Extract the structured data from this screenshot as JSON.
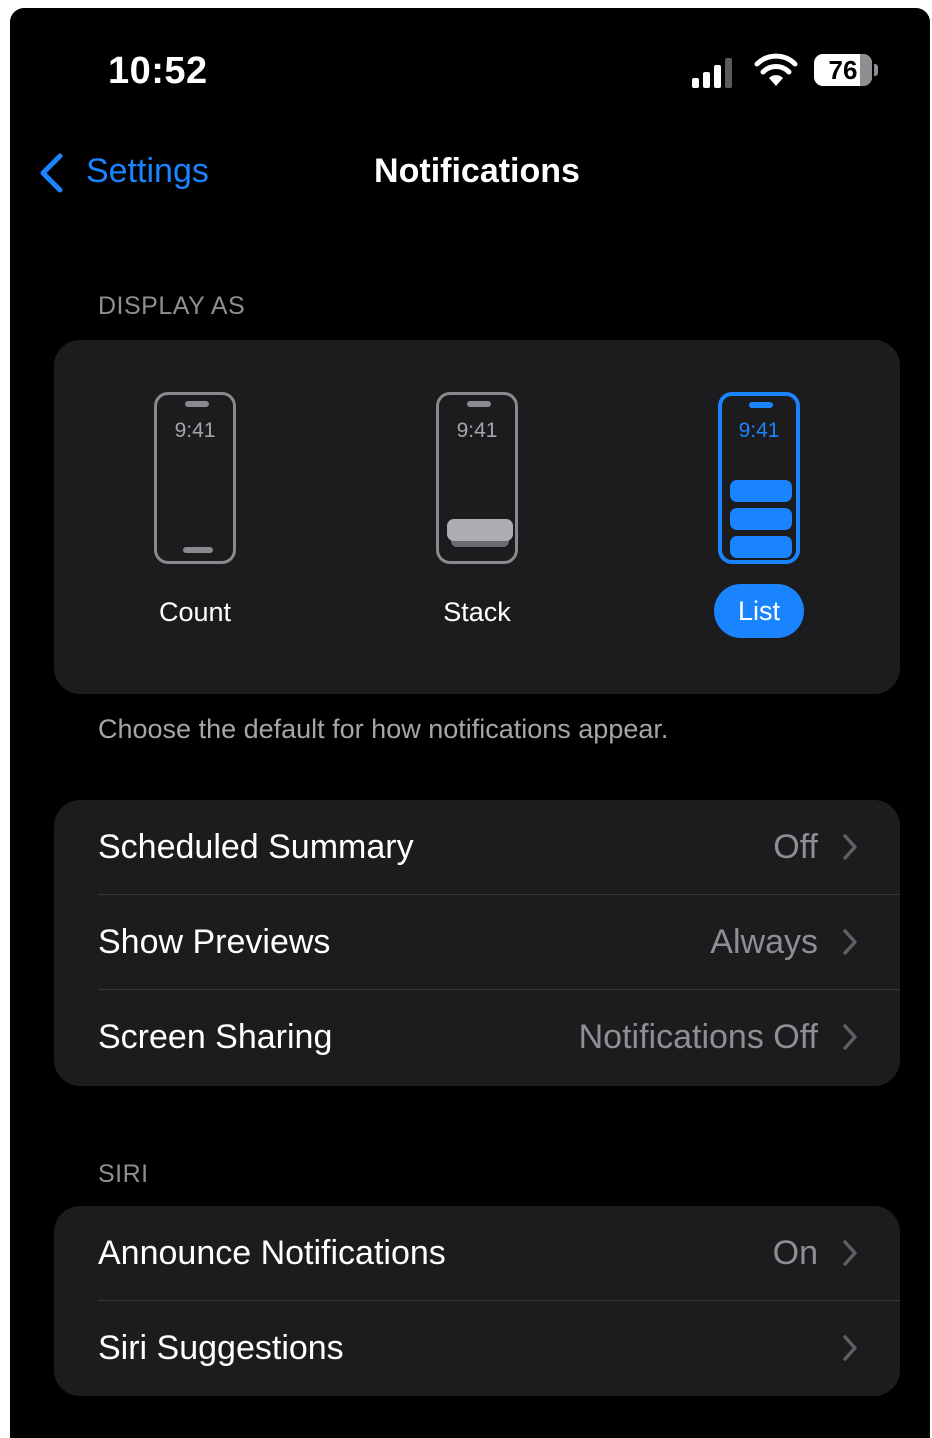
{
  "status_bar": {
    "time": "10:52",
    "battery": "76"
  },
  "nav": {
    "back_label": "Settings",
    "title": "Notifications"
  },
  "display_as": {
    "header": "DISPLAY AS",
    "preview_time": "9:41",
    "options": [
      {
        "label": "Count",
        "selected": false
      },
      {
        "label": "Stack",
        "selected": false
      },
      {
        "label": "List",
        "selected": true
      }
    ],
    "footer": "Choose the default for how notifications appear."
  },
  "general_rows": [
    {
      "label": "Scheduled Summary",
      "value": "Off"
    },
    {
      "label": "Show Previews",
      "value": "Always"
    },
    {
      "label": "Screen Sharing",
      "value": "Notifications Off"
    }
  ],
  "siri": {
    "header": "SIRI",
    "rows": [
      {
        "label": "Announce Notifications",
        "value": "On"
      },
      {
        "label": "Siri Suggestions",
        "value": ""
      }
    ]
  },
  "colors": {
    "accent": "#1a84ff",
    "background": "#000000",
    "card": "#1c1c1e",
    "secondary_text": "#8e8e93"
  }
}
